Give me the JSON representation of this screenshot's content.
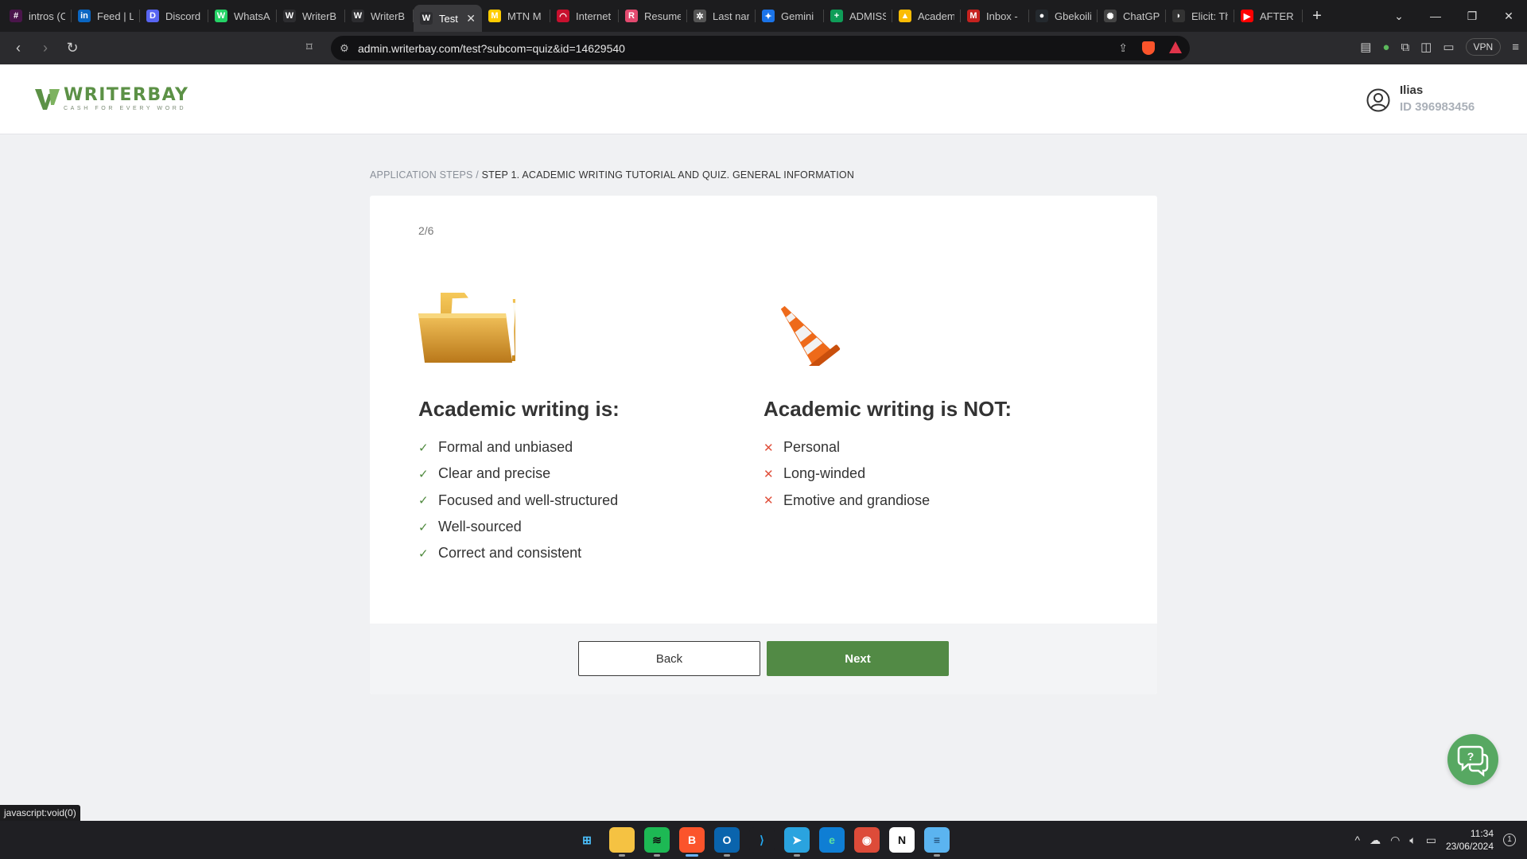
{
  "browser": {
    "tabs": [
      {
        "label": "intros (C",
        "color": "#4a154b",
        "glyph": "#"
      },
      {
        "label": "Feed | Li",
        "color": "#0a66c2",
        "glyph": "in"
      },
      {
        "label": "Discord",
        "color": "#5865f2",
        "glyph": "D"
      },
      {
        "label": "WhatsA",
        "color": "#25d366",
        "glyph": "W"
      },
      {
        "label": "WriterB",
        "color": "#2d2d30",
        "glyph": "W"
      },
      {
        "label": "WriterB",
        "color": "#2d2d30",
        "glyph": "W"
      },
      {
        "label": "Test",
        "color": "#2d2d30",
        "glyph": "W",
        "active": true
      },
      {
        "label": "MTN M",
        "color": "#ffcc00",
        "glyph": "M"
      },
      {
        "label": "Internet",
        "color": "#c8102e",
        "glyph": "◠"
      },
      {
        "label": "Resume",
        "color": "#e34a6f",
        "glyph": "R"
      },
      {
        "label": "Last nar",
        "color": "#555",
        "glyph": "✲"
      },
      {
        "label": "Gemini",
        "color": "#1a73e8",
        "glyph": "✦"
      },
      {
        "label": "ADMISS",
        "color": "#0f9d58",
        "glyph": "+"
      },
      {
        "label": "Academ",
        "color": "#fbbc04",
        "glyph": "▲"
      },
      {
        "label": "Inbox -",
        "color": "#c5221f",
        "glyph": "M"
      },
      {
        "label": "Gbekoili",
        "color": "#24292e",
        "glyph": "●"
      },
      {
        "label": "ChatGP",
        "color": "#444",
        "glyph": "✺"
      },
      {
        "label": "Elicit: Th",
        "color": "#333",
        "glyph": "◗"
      },
      {
        "label": "AFTER S",
        "color": "#ff0000",
        "glyph": "▶"
      }
    ],
    "close_tab_glyph": "✕",
    "new_tab_glyph": "+",
    "tab_list_glyph": "⌄",
    "minimize_glyph": "—",
    "restore_glyph": "❐",
    "close_window_glyph": "✕",
    "url": "admin.writerbay.com/test?subcom=quiz&id=14629540",
    "vpn_label": "VPN",
    "status_url": "javascript:void(0)"
  },
  "site": {
    "logo_name": "WRITERBAY",
    "logo_tagline": "CASH FOR EVERY WORD",
    "brand_color": "#5c9146",
    "user_name": "Ilias",
    "user_id": "ID 396983456"
  },
  "breadcrumb": {
    "root": "APPLICATION STEPS",
    "separator": " / ",
    "current": "STEP 1. ACADEMIC WRITING TUTORIAL AND QUIZ. GENERAL INFORMATION"
  },
  "quiz": {
    "step_counter": "2/6",
    "is": {
      "title": "Academic writing is:",
      "icon": "folder-icon",
      "items": [
        "Formal and unbiased",
        "Clear and precise",
        "Focused and well-structured",
        "Well-sourced",
        "Correct and consistent"
      ]
    },
    "is_not": {
      "title": "Academic writing is NOT:",
      "icon": "traffic-cone-icon",
      "items": [
        "Personal",
        "Long-winded",
        "Emotive and grandiose"
      ]
    },
    "check_glyph": "✓",
    "cross_glyph": "✕",
    "back_label": "Back",
    "next_label": "Next",
    "next_color": "#528a45"
  },
  "taskbar": {
    "apps": [
      {
        "name": "windows-start-icon",
        "glyph": "⊞",
        "color": "transparent",
        "text": "#4cc2ff"
      },
      {
        "name": "file-explorer-icon",
        "glyph": "▬",
        "color": "#f5c242",
        "text": "#f5c242"
      },
      {
        "name": "spotify-icon",
        "glyph": "≋",
        "color": "#1db954",
        "text": "#111"
      },
      {
        "name": "brave-icon",
        "glyph": "B",
        "color": "#fb542b",
        "text": "#fff"
      },
      {
        "name": "outlook-icon",
        "glyph": "O",
        "color": "#0a64ad",
        "text": "#fff"
      },
      {
        "name": "vscode-icon",
        "glyph": "⟩",
        "color": "#1f1f23",
        "text": "#23a9f2"
      },
      {
        "name": "telegram-icon",
        "glyph": "➤",
        "color": "#2aa3df",
        "text": "#fff"
      },
      {
        "name": "edge-icon",
        "glyph": "e",
        "color": "#0f7ed4",
        "text": "#5be0a0"
      },
      {
        "name": "chrome-icon",
        "glyph": "◉",
        "color": "#dd4b39",
        "text": "#fff"
      },
      {
        "name": "notion-icon",
        "glyph": "N",
        "color": "#fff",
        "text": "#111"
      },
      {
        "name": "notepad-icon",
        "glyph": "≡",
        "color": "#5bb4f0",
        "text": "#1a3f66"
      }
    ],
    "tray_chevron": "^",
    "time": "11:34",
    "date": "23/06/2024",
    "notification_count": "1"
  }
}
